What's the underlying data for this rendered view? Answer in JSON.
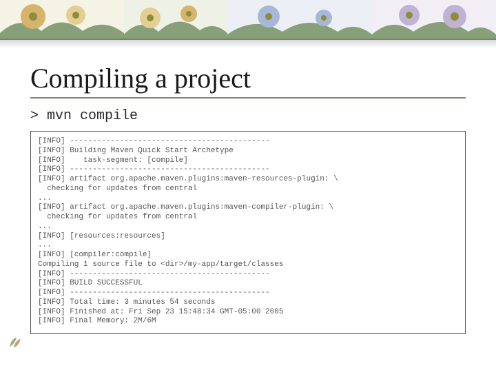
{
  "title": "Compiling a project",
  "command": "> mvn compile",
  "terminal_lines": [
    "[INFO] --------------------------------------------",
    "[INFO] Building Maven Quick Start Archetype",
    "[INFO]    task-segment: [compile]",
    "[INFO] --------------------------------------------",
    "[INFO] artifact org.apache.maven.plugins:maven-resources-plugin: \\",
    "  checking for updates from central",
    "...",
    "[INFO] artifact org.apache.maven.plugins:maven-compiler-plugin: \\",
    "  checking for updates from central",
    "...",
    "[INFO] [resources:resources]",
    "...",
    "[INFO] [compiler:compile]",
    "Compiling 1 source file to <dir>/my-app/target/classes",
    "[INFO] --------------------------------------------",
    "[INFO] BUILD SUCCESSFUL",
    "[INFO] --------------------------------------------",
    "[INFO] Total time: 3 minutes 54 seconds",
    "[INFO] Finished at: Fri Sep 23 15:48:34 GMT-05:00 2005",
    "[INFO] Final Memory: 2M/6M"
  ]
}
